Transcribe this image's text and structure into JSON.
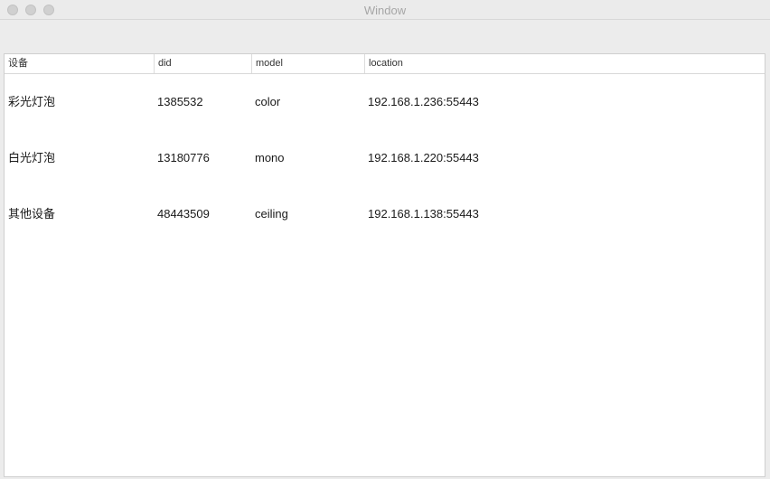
{
  "window": {
    "title": "Window"
  },
  "table": {
    "columns": [
      "设备",
      "did",
      "model",
      "location"
    ],
    "rows": [
      [
        "彩光灯泡",
        "1385532",
        "color",
        "192.168.1.236:55443"
      ],
      [
        "白光灯泡",
        "13180776",
        "mono",
        "192.168.1.220:55443"
      ],
      [
        "其他设备",
        "48443509",
        "ceiling",
        "192.168.1.138:55443"
      ]
    ]
  }
}
